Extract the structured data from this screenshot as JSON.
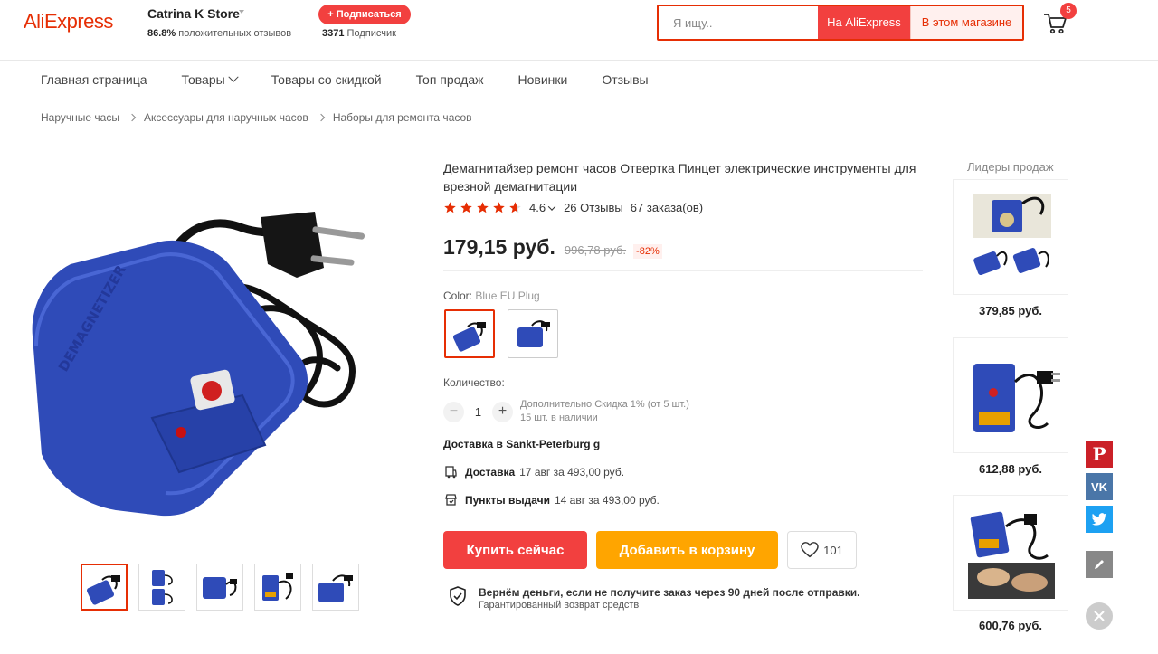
{
  "header": {
    "logo": "AliExpress",
    "store_name": "Catrina K Store",
    "store_positive_pct": "86.8%",
    "store_positive_label": "положительных отзывов",
    "subscribe_label": "+ Подписаться",
    "followers_count": "3371",
    "followers_label": "Подписчик",
    "search_placeholder": "Я ищу..",
    "search_aliexpress_label": "На AliExpress",
    "search_store_label": "В этом магазине",
    "cart_count": "5",
    "colors": {
      "accent": "#e62e04",
      "button_red": "#f2403f",
      "button_orange": "#ffa500"
    }
  },
  "nav": {
    "items": [
      {
        "label": "Главная страница"
      },
      {
        "label": "Товары",
        "has_dropdown": true
      },
      {
        "label": "Товары со скидкой"
      },
      {
        "label": "Топ продаж"
      },
      {
        "label": "Новинки"
      },
      {
        "label": "Отзывы"
      }
    ]
  },
  "breadcrumb": [
    "Наручные часы",
    "Аксессуары для наручных часов",
    "Наборы для ремонта часов"
  ],
  "product": {
    "title": "Демагнитайзер ремонт часов Отвертка Пинцет электрические инструменты для врезной демагнитации",
    "rating": "4.6",
    "rating_stars": 4.6,
    "reviews": "26 Отзывы",
    "orders": "67 заказа(ов)",
    "price": "179,15 руб.",
    "old_price": "996,78 руб.",
    "discount": "-82%",
    "color_label": "Color:",
    "color_value": "Blue EU Plug",
    "quantity_label": "Количество:",
    "quantity_minus": "−",
    "quantity_value": "1",
    "quantity_plus": "+",
    "quantity_discount": "Дополнительно Скидка 1% (от 5 шт.)",
    "quantity_stock": "15 шт. в наличии",
    "delivery_to": "Доставка в Sankt-Peterburg g",
    "shipping": [
      {
        "icon": "delivery-truck-icon",
        "label": "Доставка",
        "detail": "17 авг за 493,00 руб."
      },
      {
        "icon": "pickup-point-icon",
        "label": "Пункты выдачи",
        "detail": "14 авг за 493,00 руб."
      }
    ],
    "buy_now": "Купить сейчас",
    "add_to_cart": "Добавить в корзину",
    "wishlist_count": "101",
    "guarantee_main": "Вернём деньги, если не получите заказ через 90 дней после отправки.",
    "guarantee_sub": "Гарантированный возврат средств"
  },
  "best_sellers": {
    "title": "Лидеры продаж",
    "items": [
      {
        "price": "379,85 руб."
      },
      {
        "price": "612,88 руб."
      },
      {
        "price": "600,76 руб."
      }
    ]
  },
  "share": {
    "pinterest": "P",
    "vk": "VK"
  }
}
